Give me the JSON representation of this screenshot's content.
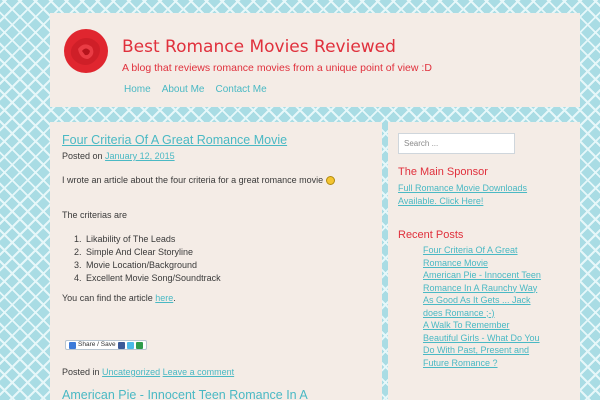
{
  "site": {
    "title": "Best Romance Movies Reviewed",
    "tagline": "A blog that reviews romance movies from a unique point of view :D",
    "logo_icon": "red-rose-icon",
    "nav": [
      "Home",
      "About Me",
      "Contact Me"
    ]
  },
  "post": {
    "title": "Four Criteria Of A Great Romance Movie",
    "posted_on_label": "Posted on",
    "date": "January 12, 2015",
    "intro": "I wrote an article about the four criteria for a great romance movie",
    "criterias_label": "The criterias are",
    "criteria": [
      "Likability of The Leads",
      "Simple And Clear Storyline",
      "Movie Location/Background",
      "Excellent Movie Song/Soundtrack"
    ],
    "find_article_prefix": "You can find the article",
    "find_article_link": "here",
    "find_article_suffix": ".",
    "share_label": "Share / Save",
    "posted_in_label": "Posted in",
    "category": "Uncategorized",
    "comment_link": "Leave a comment"
  },
  "next_post": {
    "title": "American Pie - Innocent Teen Romance In A"
  },
  "sidebar": {
    "search_placeholder": "Search ...",
    "sponsor_title": "The Main Sponsor",
    "sponsor_link": "Full Romance Movie Downloads Available. Click Here!",
    "recent_title": "Recent Posts",
    "recent_posts": [
      "Four Criteria Of A Great Romance Movie",
      "American Pie - Innocent Teen Romance In A Raunchy Way",
      "As Good As It Gets ... Jack does Romance ;-)",
      "A Walk To Remember",
      "Beautiful Girls - What Do You Do With Past, Present and Future Romance ?"
    ]
  },
  "colors": {
    "accent_red": "#e0303c",
    "link_teal": "#4ab9c4",
    "panel_bg": "#f4ece6",
    "page_bg": "#a9dce4"
  }
}
